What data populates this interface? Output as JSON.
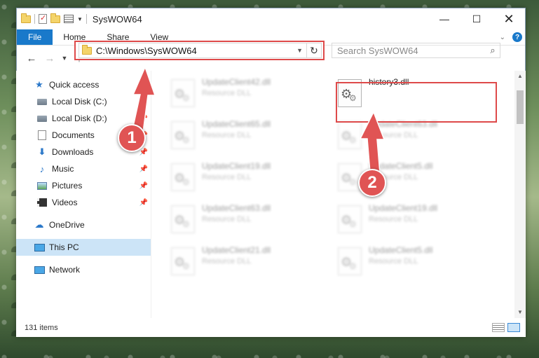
{
  "window": {
    "title": "SysWOW64",
    "controls": {
      "minimize": "—",
      "maximize": "☐",
      "close": "✕"
    }
  },
  "ribbon": {
    "tabs": [
      "File",
      "Home",
      "Share",
      "View"
    ],
    "help": "?"
  },
  "nav": {
    "address": "C:\\Windows\\SysWOW64",
    "search_placeholder": "Search SysWOW64"
  },
  "sidebar": {
    "items": [
      {
        "label": "Quick access",
        "icon": "star-icon"
      },
      {
        "label": "Local Disk (C:)",
        "icon": "drive-icon",
        "pinned": true
      },
      {
        "label": "Local Disk (D:)",
        "icon": "drive-icon",
        "pinned": true
      },
      {
        "label": "Documents",
        "icon": "documents-icon",
        "pinned": true
      },
      {
        "label": "Downloads",
        "icon": "download-icon",
        "pinned": true
      },
      {
        "label": "Music",
        "icon": "music-icon",
        "pinned": true
      },
      {
        "label": "Pictures",
        "icon": "pictures-icon",
        "pinned": true
      },
      {
        "label": "Videos",
        "icon": "videos-icon",
        "pinned": true
      },
      {
        "label": "OneDrive",
        "icon": "cloud-icon"
      },
      {
        "label": "This PC",
        "icon": "computer-icon",
        "selected": true
      },
      {
        "label": "Network",
        "icon": "network-icon"
      }
    ]
  },
  "files": {
    "left": [
      {
        "name": "UpdateClient42.dll",
        "type": "Resource DLL"
      },
      {
        "name": "UpdateClient65.dll",
        "type": "Resource DLL"
      },
      {
        "name": "UpdateClient19.dll",
        "type": "Resource DLL"
      },
      {
        "name": "UpdateClient63.dll",
        "type": "Resource DLL"
      },
      {
        "name": "UpdateClient21.dll",
        "type": "Resource DLL"
      }
    ],
    "right": [
      {
        "name": "history3.dll",
        "type": ""
      },
      {
        "name": "UpdateClient63.dll",
        "type": "Resource DLL"
      },
      {
        "name": "UpdateClient5.dll",
        "type": "Resource DLL"
      },
      {
        "name": "UpdateClient19.dll",
        "type": "Resource DLL"
      },
      {
        "name": "UpdateClient5.dll",
        "type": "Resource DLL"
      }
    ]
  },
  "status": {
    "items": "131 items"
  },
  "callouts": [
    "1",
    "2"
  ],
  "colors": {
    "accent": "#1979ca",
    "highlight": "#de4a4a",
    "selected": "#cce4f7"
  }
}
